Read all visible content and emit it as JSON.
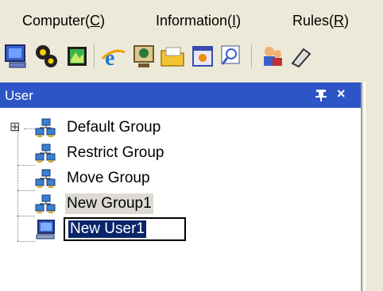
{
  "menubar": {
    "items": [
      {
        "label": "Computer(C)",
        "prefix": "Computer(",
        "key": "C",
        "suffix": ")"
      },
      {
        "label": "Information(I)",
        "prefix": "Information(",
        "key": "I",
        "suffix": ")"
      },
      {
        "label": "Rules(R)",
        "prefix": "Rules(",
        "key": "R",
        "suffix": ")"
      }
    ]
  },
  "toolbar": {
    "icons": [
      "computer-icon",
      "settings-gears-icon",
      "picture-icon",
      "internet-explorer-icon",
      "monitor-icon",
      "folder-icon",
      "window-icon",
      "search-icon",
      "users-icon",
      "tool-icon"
    ]
  },
  "panel": {
    "title": "User",
    "pin_glyph": "↑",
    "close_glyph": "×"
  },
  "tree": {
    "expander": "⊞",
    "items": [
      {
        "label": "Default Group",
        "type": "group",
        "expandable": true
      },
      {
        "label": "Restrict Group",
        "type": "group"
      },
      {
        "label": "Move Group",
        "type": "group"
      },
      {
        "label": "New Group1",
        "type": "group",
        "highlighted": true
      },
      {
        "label": "New User1",
        "type": "user",
        "editing": true
      }
    ]
  },
  "colors": {
    "header_bg": "#2e55c6",
    "selection_bg": "#0a246a",
    "chrome_bg": "#ece9d8"
  }
}
